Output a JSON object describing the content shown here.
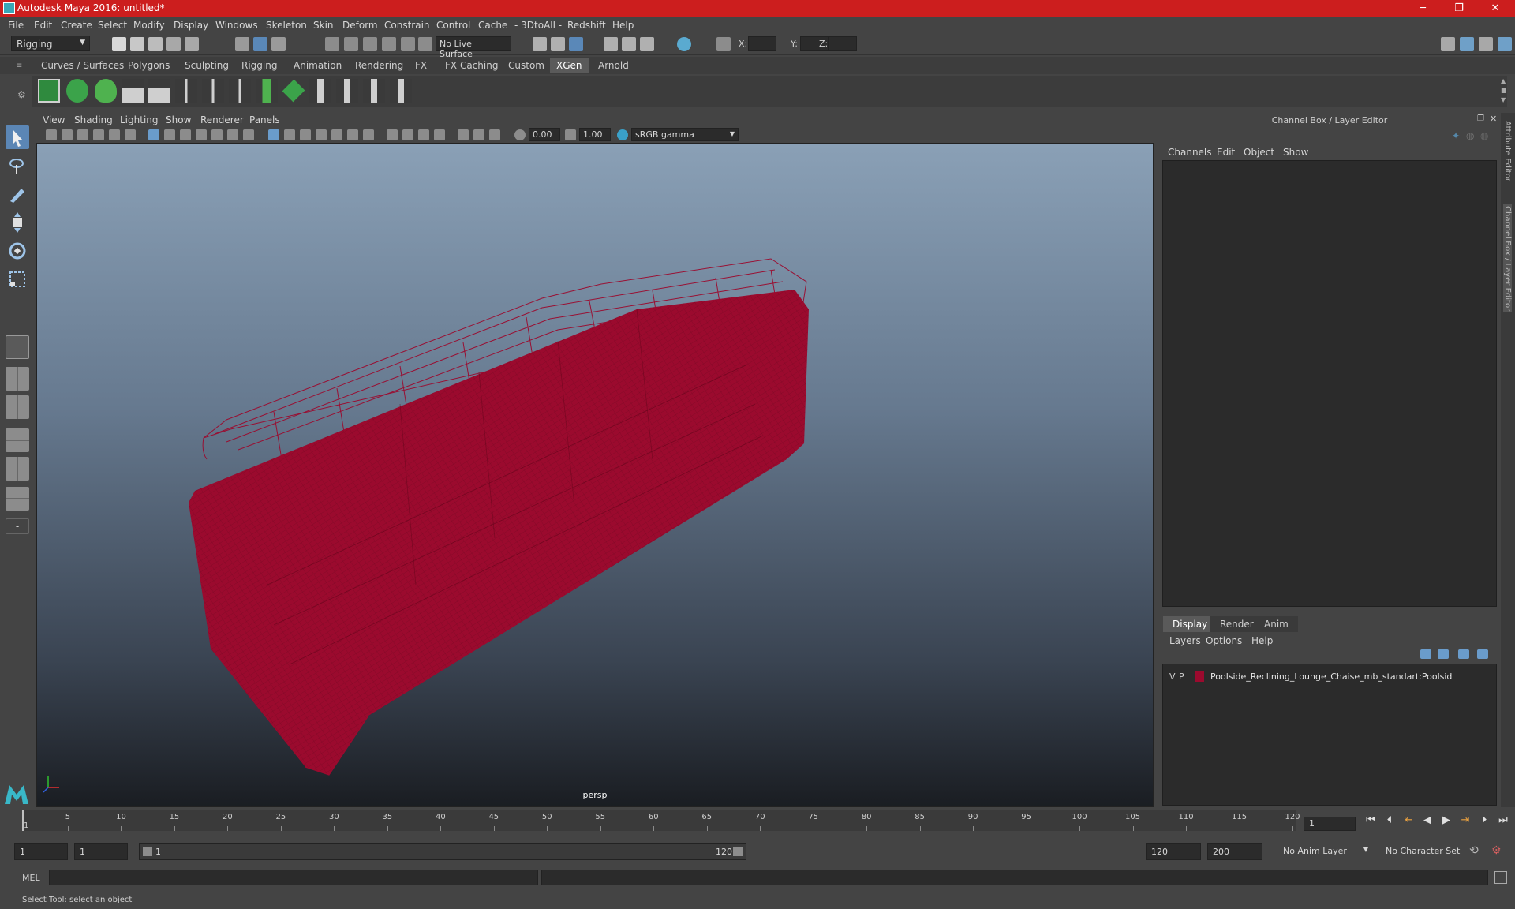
{
  "window": {
    "title": "Autodesk Maya 2016: untitled*",
    "controls": [
      "─",
      "❐",
      "✕"
    ]
  },
  "menubar": [
    "File",
    "Edit",
    "Create",
    "Select",
    "Modify",
    "Display",
    "Windows",
    "Skeleton",
    "Skin",
    "Deform",
    "Constrain",
    "Control",
    "Cache",
    "- 3DtoAll -",
    "Redshift",
    "Help"
  ],
  "statusline": {
    "mode": "Rigging",
    "live_surface": "No Live Surface",
    "x_label": "X:",
    "y_label": "Y:",
    "z_label": "Z:"
  },
  "shelf_tabs": [
    "Curves / Surfaces",
    "Polygons",
    "Sculpting",
    "Rigging",
    "Animation",
    "Rendering",
    "FX",
    "FX Caching",
    "Custom",
    "XGen",
    "Arnold"
  ],
  "shelf_active": "XGen",
  "viewport": {
    "menus": [
      "View",
      "Shading",
      "Lighting",
      "Show",
      "Renderer",
      "Panels"
    ],
    "exposure": "0.00",
    "gamma": "1.00",
    "color_space": "sRGB gamma",
    "camera": "persp",
    "wire_color": "#9b0a2e"
  },
  "channel_box": {
    "title": "Channel Box / Layer Editor",
    "menus": [
      "Channels",
      "Edit",
      "Object",
      "Show"
    ]
  },
  "layer_editor": {
    "tabs": [
      "Display",
      "Render",
      "Anim"
    ],
    "active_tab": "Display",
    "menus": [
      "Layers",
      "Options",
      "Help"
    ],
    "layer": {
      "v": "V",
      "p": "P",
      "color": "#9b0a2e",
      "name": "Poolside_Reclining_Lounge_Chaise_mb_standart:Poolsid"
    }
  },
  "side_tabs": [
    "Attribute Editor",
    "Channel Box / Layer Editor"
  ],
  "timeline": {
    "ticks": [
      "5",
      "10",
      "15",
      "20",
      "25",
      "30",
      "35",
      "40",
      "45",
      "50",
      "55",
      "60",
      "65",
      "70",
      "75",
      "80",
      "85",
      "90",
      "95",
      "100",
      "105",
      "110",
      "115",
      "120"
    ],
    "current_frame_marker": "1",
    "current_frame": "1"
  },
  "range": {
    "start": "1",
    "playback_start": "1",
    "slider_start": "1",
    "slider_end": "120",
    "playback_end": "120",
    "end": "200",
    "anim_layer": "No Anim Layer",
    "character_set": "No Character Set"
  },
  "command_line": {
    "label": "MEL"
  },
  "help_line": "Select Tool: select an object"
}
